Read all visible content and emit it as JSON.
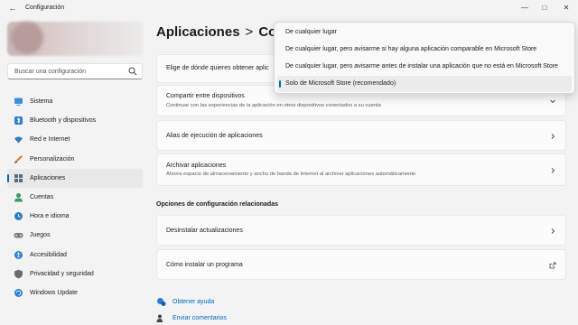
{
  "window": {
    "title": "Configuración"
  },
  "search": {
    "placeholder": "Buscar una configuración"
  },
  "sidebar": {
    "items": [
      {
        "label": "Sistema",
        "icon": "monitor-icon",
        "color": "#3a8ee6"
      },
      {
        "label": "Bluetooth y dispositivos",
        "icon": "bluetooth-icon",
        "color": "#2b7bd8"
      },
      {
        "label": "Red e Internet",
        "icon": "wifi-icon",
        "color": "#2b7bd8"
      },
      {
        "label": "Personalización",
        "icon": "brush-icon",
        "color": "#d97b2b"
      },
      {
        "label": "Aplicaciones",
        "icon": "apps-icon",
        "color": "#5a6b7a",
        "active": true
      },
      {
        "label": "Cuentas",
        "icon": "person-icon",
        "color": "#2e9e6b"
      },
      {
        "label": "Hora e idioma",
        "icon": "globe-clock-icon",
        "color": "#2b7bd8"
      },
      {
        "label": "Juegos",
        "icon": "gamepad-icon",
        "color": "#7a7a7a"
      },
      {
        "label": "Accesibilidad",
        "icon": "accessibility-icon",
        "color": "#2b7bd8"
      },
      {
        "label": "Privacidad y seguridad",
        "icon": "shield-icon",
        "color": "#6b6b6b"
      },
      {
        "label": "Windows Update",
        "icon": "update-icon",
        "color": "#2b7bd8"
      }
    ]
  },
  "breadcrumb": {
    "parent": "Aplicaciones",
    "separator": ">",
    "current": "Con"
  },
  "cards": {
    "install_source": {
      "title": "Elige de dónde quieres obtener aplic"
    },
    "share": {
      "title": "Compartir entre dispositivos",
      "desc": "Continuar con las experiencias de la aplicación en otros dispositivos conectados a su cuenta"
    },
    "alias": {
      "title": "Alias de ejecución de aplicaciones"
    },
    "archive": {
      "title": "Archivar aplicaciones",
      "desc": "Ahorra espacio de almacenamiento y ancho de banda de Internet al archivar aplicaciones automáticamente"
    }
  },
  "related": {
    "heading": "Opciones de configuración relacionadas",
    "uninstall_updates": "Desinstalar actualizaciones",
    "install_program": "Cómo instalar un programa"
  },
  "links": {
    "help": "Obtener ayuda",
    "feedback": "Enviar comentarios"
  },
  "dropdown": {
    "options": [
      "De cualquier lugar",
      "De cualquier lugar, pero avisarme si hay alguna aplicación comparable en Microsoft Store",
      "De cualquier lugar, pero avisarme antes de instalar una aplicación que no está en Microsoft Store",
      "Solo de Microsoft Store (recomendado)"
    ],
    "selected_index": 3
  },
  "colors": {
    "accent": "#0067c0",
    "background": "#f3f3f3"
  }
}
